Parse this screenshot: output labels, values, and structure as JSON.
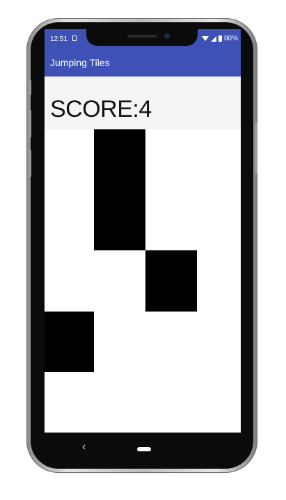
{
  "status_bar": {
    "time": "12:51",
    "battery": "80%",
    "icons": [
      "sim-icon",
      "wifi-icon",
      "signal-icon",
      "battery-icon"
    ]
  },
  "app_bar": {
    "title": "Jumping Tiles",
    "color": "#3f51b5"
  },
  "score": {
    "text": "SCORE:4"
  },
  "game": {
    "tile_color": "#000000",
    "background_color": "#ffffff",
    "tiles": [
      "tile-1",
      "tile-2",
      "tile-3"
    ]
  },
  "nav_bar": {
    "back_glyph": "‹",
    "icons": [
      "back-icon",
      "home-icon"
    ]
  }
}
